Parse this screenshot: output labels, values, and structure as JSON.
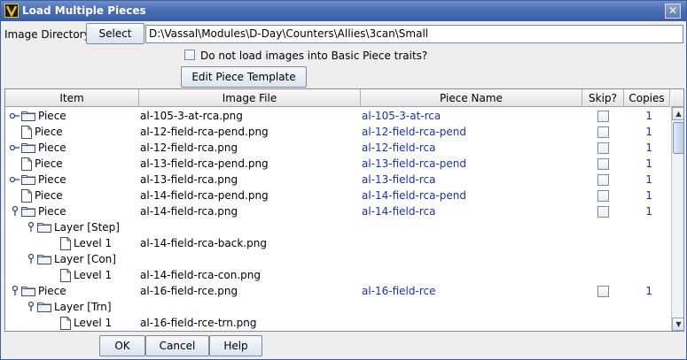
{
  "window": {
    "title": "Load Multiple Pieces",
    "close_glyph": "✕"
  },
  "directory": {
    "label": "Image Directory:",
    "select_label": "Select",
    "path": "D:\\Vassal\\Modules\\D-Day\\Counters\\Allies\\3can\\Small"
  },
  "options": {
    "no_basic_piece_label": "Do not load images into Basic Piece traits?",
    "edit_template_label": "Edit Piece Template"
  },
  "table": {
    "columns": [
      "Item",
      "Image File",
      "Piece Name",
      "Skip?",
      "Copies"
    ],
    "rows": [
      {
        "kind": "piece",
        "handle": "collapsed",
        "item": "Piece",
        "image": "al-105-3-at-rca.png",
        "name": "al-105-3-at-rca",
        "copies": "1"
      },
      {
        "kind": "leaf",
        "item": "Piece",
        "image": "al-12-field-rca-pend.png",
        "name": "al-12-field-rca-pend",
        "copies": "1"
      },
      {
        "kind": "piece",
        "handle": "collapsed",
        "item": "Piece",
        "image": "al-12-field-rca.png",
        "name": "al-12-field-rca",
        "copies": "1"
      },
      {
        "kind": "leaf",
        "item": "Piece",
        "image": "al-13-field-rca-pend.png",
        "name": "al-13-field-rca-pend",
        "copies": "1"
      },
      {
        "kind": "piece",
        "handle": "collapsed",
        "item": "Piece",
        "image": "al-13-field-rca.png",
        "name": "al-13-field-rca",
        "copies": "1"
      },
      {
        "kind": "leaf",
        "item": "Piece",
        "image": "al-14-field-rca-pend.png",
        "name": "al-14-field-rca-pend",
        "copies": "1"
      },
      {
        "kind": "piece",
        "handle": "expanded",
        "item": "Piece",
        "image": "al-14-field-rca.png",
        "name": "al-14-field-rca",
        "copies": "1"
      },
      {
        "kind": "layer",
        "item": "Layer [Step]",
        "image": "",
        "name": "",
        "copies": ""
      },
      {
        "kind": "level",
        "item": "Level 1",
        "image": "al-14-field-rca-back.png",
        "name": "",
        "copies": ""
      },
      {
        "kind": "layer",
        "item": "Layer [Con]",
        "image": "",
        "name": "",
        "copies": ""
      },
      {
        "kind": "level",
        "item": "Level 1",
        "image": "al-14-field-rca-con.png",
        "name": "",
        "copies": ""
      },
      {
        "kind": "piece",
        "handle": "expanded",
        "item": "Piece",
        "image": "al-16-field-rce.png",
        "name": "al-16-field-rce",
        "copies": "1"
      },
      {
        "kind": "layer",
        "item": "Layer [Trn]",
        "image": "",
        "name": "",
        "copies": ""
      },
      {
        "kind": "level",
        "item": "Level 1",
        "image": "al-16-field-rce-trn.png",
        "name": "",
        "copies": ""
      }
    ]
  },
  "buttons": {
    "ok": "OK",
    "cancel": "Cancel",
    "help": "Help"
  },
  "scrollbar": {
    "up": "▲",
    "down": "▼"
  }
}
